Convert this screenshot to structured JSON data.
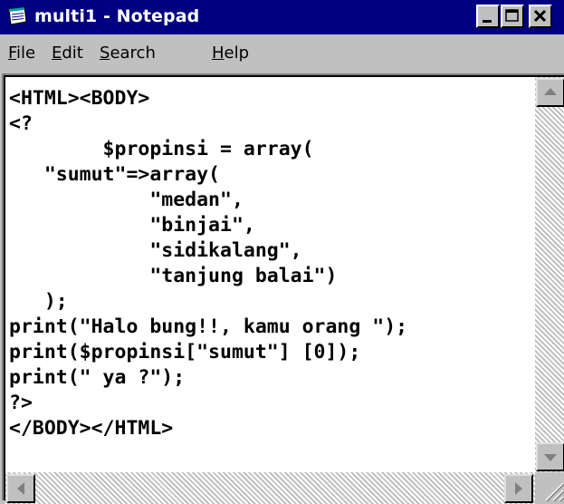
{
  "window": {
    "title": "multi1 - Notepad",
    "app_icon": "notepad-icon",
    "controls": {
      "minimize": "minimize-icon",
      "maximize": "maximize-icon",
      "close": "close-icon"
    }
  },
  "menu": [
    {
      "label": "File",
      "accel": "F",
      "rest": "ile"
    },
    {
      "label": "Edit",
      "accel": "E",
      "rest": "dit"
    },
    {
      "label": "Search",
      "accel": "S",
      "rest": "earch"
    },
    {
      "label": "Help",
      "accel": "H",
      "rest": "elp"
    }
  ],
  "editor": {
    "content": "<HTML><BODY>\n<?\n        $propinsi = array(\n   \"sumut\"=>array(\n            \"medan\",\n            \"binjai\",\n            \"sidikalang\",\n            \"tanjung balai\")\n   );\nprint(\"Halo bung!!, kamu orang \");\nprint($propinsi[\"sumut\"] [0]);\nprint(\" ya ?\");\n?>\n</BODY></HTML>"
  },
  "colors": {
    "titlebar": "#000080",
    "face": "#c0c0c0",
    "editor_bg": "#ffffff"
  }
}
